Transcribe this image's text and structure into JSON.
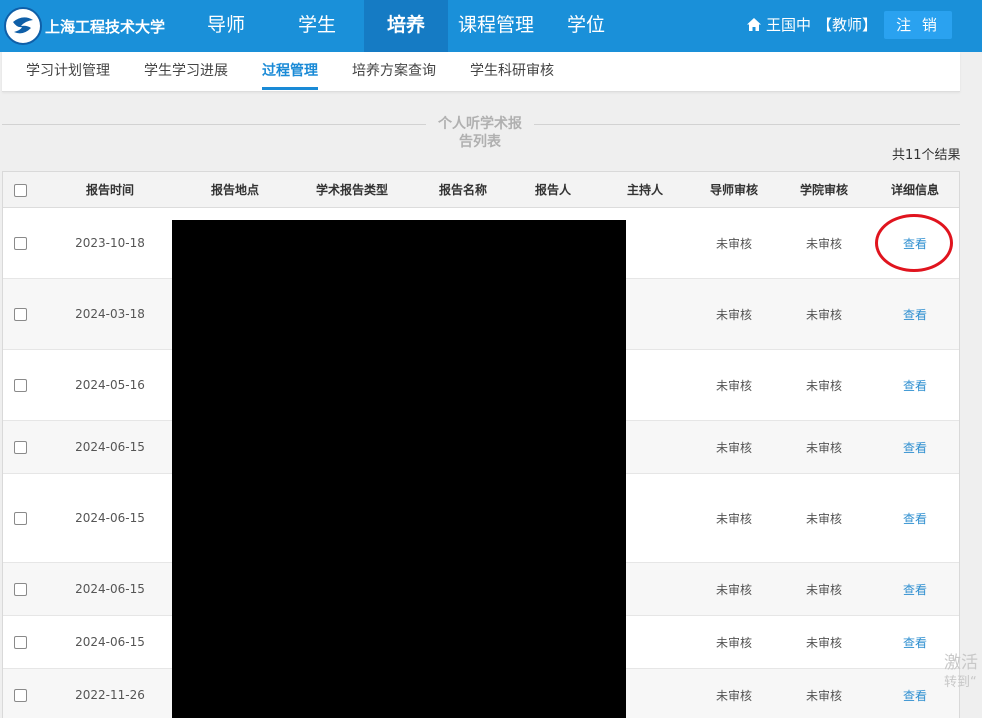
{
  "brand": {
    "name": "上海工程技术大学"
  },
  "nav": {
    "items": [
      {
        "label": "导师"
      },
      {
        "label": "学生"
      },
      {
        "label": "培养",
        "active": true
      },
      {
        "label": "课程管理"
      },
      {
        "label": "学位"
      }
    ]
  },
  "user": {
    "name": "王国中",
    "role": "【教师】",
    "logout_label": "注 销"
  },
  "subnav": {
    "items": [
      {
        "label": "学习计划管理"
      },
      {
        "label": "学生学习进展"
      },
      {
        "label": "过程管理",
        "active": true
      },
      {
        "label": "培养方案查询"
      },
      {
        "label": "学生科研审核"
      }
    ]
  },
  "page": {
    "title_line1": "个人听学术报",
    "title_line2": "告列表",
    "result_count": "共11个结果"
  },
  "table": {
    "headers": [
      "报告时间",
      "报告地点",
      "学术报告类型",
      "报告名称",
      "报告人",
      "主持人",
      "导师审核",
      "学院审核",
      "详细信息"
    ],
    "rows": [
      {
        "date": "2023-10-18",
        "tutor_review": "未审核",
        "college_review": "未审核",
        "detail": "查看"
      },
      {
        "date": "2024-03-18",
        "tutor_review": "未审核",
        "college_review": "未审核",
        "detail": "查看"
      },
      {
        "date": "2024-05-16",
        "tutor_review": "未审核",
        "college_review": "未审核",
        "detail": "查看"
      },
      {
        "date": "2024-06-15",
        "tutor_review": "未审核",
        "college_review": "未审核",
        "detail": "查看"
      },
      {
        "date": "2024-06-15",
        "tutor_review": "未审核",
        "college_review": "未审核",
        "detail": "查看"
      },
      {
        "date": "2024-06-15",
        "tutor_review": "未审核",
        "college_review": "未审核",
        "detail": "查看"
      },
      {
        "date": "2024-06-15",
        "tutor_review": "未审核",
        "college_review": "未审核",
        "detail": "查看"
      },
      {
        "date": "2022-11-26",
        "tutor_review": "未审核",
        "college_review": "未审核",
        "detail": "查看"
      }
    ]
  },
  "watermark": {
    "line1": "激活",
    "line2": "转到“"
  },
  "colors": {
    "nav_bg": "#1a90d9",
    "nav_active": "#157bc4",
    "link": "#2f8fd0",
    "highlight_circle": "#e0141e"
  }
}
